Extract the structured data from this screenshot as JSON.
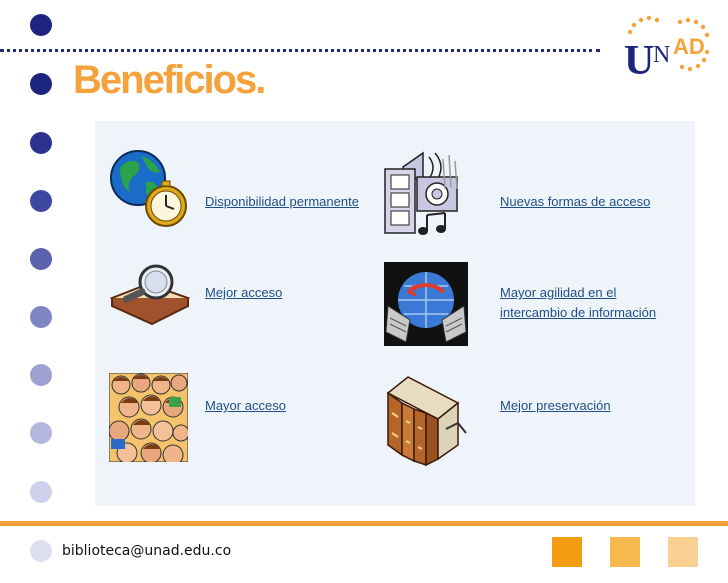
{
  "header": {
    "title": "Beneficios",
    "title_suffix": ".",
    "logo_text": {
      "u": "U",
      "n": "N",
      "ad": "AD"
    }
  },
  "items": [
    {
      "label": "Disponibilidad permanente",
      "icon": "globe-clock-icon"
    },
    {
      "label": "Nuevas formas de acceso",
      "icon": "multimedia-icon"
    },
    {
      "label": "Mejor acceso",
      "icon": "magnifier-book-icon"
    },
    {
      "label_line1": "Mayor agilidad en el",
      "label_line2": "intercambio de información",
      "icon": "data-exchange-icon"
    },
    {
      "label": "Mayor acceso",
      "icon": "crowd-icon"
    },
    {
      "label": "Mejor preservación",
      "icon": "books-icon"
    }
  ],
  "footer": {
    "email": "biblioteca@unad.edu.co"
  },
  "colors": {
    "accent": "#f5a23c",
    "navy": "#1f2a7a",
    "link": "#1f4f87",
    "panel": "#eef4f9"
  }
}
